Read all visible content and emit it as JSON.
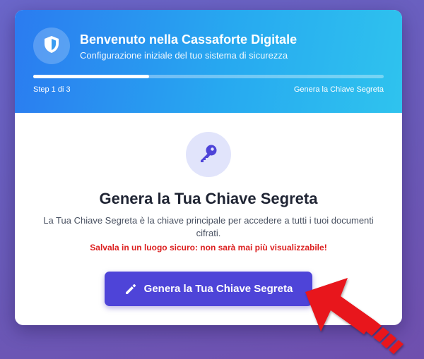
{
  "header": {
    "icon": "shield-icon",
    "title": "Benvenuto nella Cassaforte Digitale",
    "subtitle": "Configurazione iniziale del tuo sistema di sicurezza",
    "progress": 0.33,
    "step_label": "Step 1 di 3",
    "step_name": "Genera la Chiave Segreta"
  },
  "content": {
    "icon": "key-icon",
    "title": "Genera la Tua Chiave Segreta",
    "description": "La Tua Chiave Segreta è la chiave principale per accedere a tutti i tuoi documenti cifrati.",
    "warning": "Salvala in un luogo sicuro: non sarà mai più visualizzabile!",
    "button_label": "Genera la Tua Chiave Segreta",
    "button_icon": "pencil-icon"
  },
  "annotation": {
    "icon": "red-arrow-pointer",
    "color": "#e8141c"
  },
  "colors": {
    "header_start": "#2b7bf0",
    "header_end": "#2fc3ee",
    "button": "#4e44d8",
    "warning": "#dc1f1f",
    "background": "#6a5ab8"
  }
}
